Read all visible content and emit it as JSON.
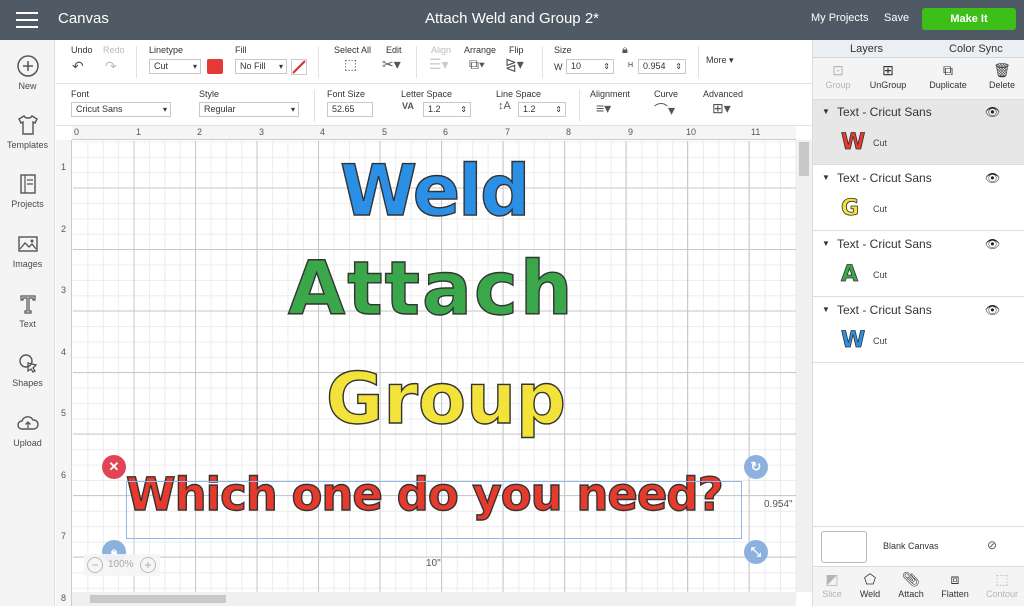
{
  "topbar": {
    "app_title": "Canvas",
    "doc_title": "Attach Weld and Group 2*",
    "my_projects": "My Projects",
    "save": "Save",
    "make_it": "Make It"
  },
  "leftbar": [
    {
      "label": "New",
      "icon": "plus-circle-icon"
    },
    {
      "label": "Templates",
      "icon": "shirt-icon"
    },
    {
      "label": "Projects",
      "icon": "notebook-icon"
    },
    {
      "label": "Images",
      "icon": "image-icon"
    },
    {
      "label": "Text",
      "icon": "text-icon"
    },
    {
      "label": "Shapes",
      "icon": "shapes-icon"
    },
    {
      "label": "Upload",
      "icon": "cloud-upload-icon"
    }
  ],
  "toolbar": {
    "undo": "Undo",
    "redo": "Redo",
    "linetype_label": "Linetype",
    "linetype_value": "Cut",
    "fill_label": "Fill",
    "fill_value": "No Fill",
    "fill_color": "#e53935",
    "select_all": "Select All",
    "edit": "Edit",
    "align": "Align",
    "arrange": "Arrange",
    "flip": "Flip",
    "size_label": "Size",
    "size_w_label": "W",
    "size_w": "10",
    "size_h_label": "H",
    "size_h": "0.954",
    "more": "More",
    "font_label": "Font",
    "font_value": "Cricut Sans",
    "style_label": "Style",
    "style_value": "Regular",
    "font_size_label": "Font Size",
    "font_size_value": "52.65",
    "letter_space_label": "Letter Space",
    "letter_space_value": "1.2",
    "line_space_label": "Line Space",
    "line_space_value": "1.2",
    "alignment_label": "Alignment",
    "curve_label": "Curve",
    "advanced_label": "Advanced"
  },
  "canvas": {
    "ruler_top": [
      "0",
      "1",
      "2",
      "3",
      "4",
      "5",
      "6",
      "7",
      "8",
      "9",
      "10",
      "11"
    ],
    "ruler_left": [
      "1",
      "2",
      "3",
      "4",
      "5",
      "6",
      "7",
      "8"
    ],
    "words": {
      "weld": "Weld",
      "attach": "Attach",
      "group": "Group",
      "which": "Which one do you need?"
    },
    "dim_h": "0.954\"",
    "dim_w": "10\"",
    "zoom": "100%"
  },
  "rpanel": {
    "tab_layers": "Layers",
    "tab_colorsync": "Color Sync",
    "actions": [
      {
        "label": "Group",
        "icon": "group-icon",
        "enabled": false
      },
      {
        "label": "UnGroup",
        "icon": "ungroup-icon",
        "enabled": true
      },
      {
        "label": "Duplicate",
        "icon": "duplicate-icon",
        "enabled": true
      },
      {
        "label": "Delete",
        "icon": "trash-icon",
        "enabled": true
      }
    ],
    "layers": [
      {
        "title": "Text - Cricut Sans",
        "letter": "W",
        "color": "#e63a2c",
        "op": "Cut"
      },
      {
        "title": "Text - Cricut Sans",
        "letter": "G",
        "color": "#f2e23a",
        "op": "Cut"
      },
      {
        "title": "Text - Cricut Sans",
        "letter": "A",
        "color": "#3aa84a",
        "op": "Cut"
      },
      {
        "title": "Text - Cricut Sans",
        "letter": "W",
        "color": "#2b8fe6",
        "op": "Cut"
      }
    ],
    "blank_canvas": "Blank Canvas",
    "bottom_actions": [
      {
        "label": "Slice",
        "icon": "slice-icon",
        "enabled": false
      },
      {
        "label": "Weld",
        "icon": "weld-icon",
        "enabled": true
      },
      {
        "label": "Attach",
        "icon": "paperclip-icon",
        "enabled": true
      },
      {
        "label": "Flatten",
        "icon": "flatten-icon",
        "enabled": true
      },
      {
        "label": "Contour",
        "icon": "contour-icon",
        "enabled": false
      }
    ]
  }
}
